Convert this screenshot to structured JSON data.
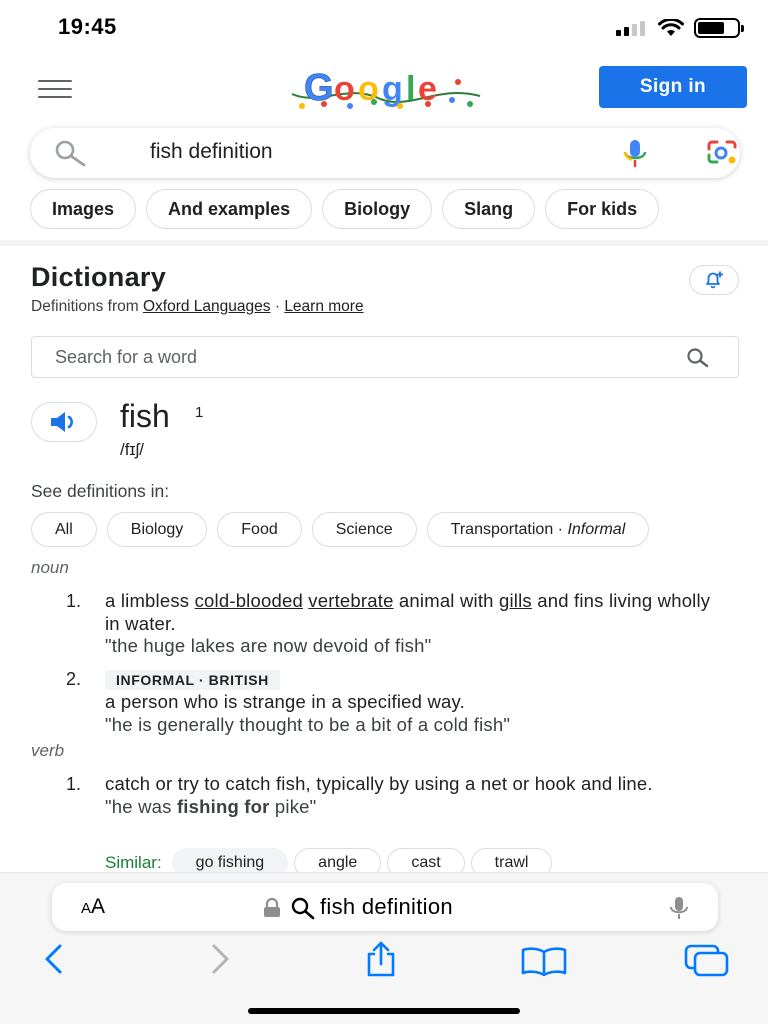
{
  "status_bar": {
    "time": "19:45"
  },
  "header": {
    "sign_in_label": "Sign in",
    "logo_alt": "Google"
  },
  "search": {
    "query": "fish definition"
  },
  "chips": [
    "Images",
    "And examples",
    "Biology",
    "Slang",
    "For kids"
  ],
  "dictionary": {
    "title": "Dictionary",
    "source_prefix": "Definitions from ",
    "source_link": "Oxford Languages",
    "separator": " · ",
    "learn_more": "Learn more",
    "word_search_placeholder": "Search for a word",
    "headword": "fish",
    "headword_sup": "1",
    "pronunciation": "/fɪʃ/",
    "see_definitions_label": "See definitions in:",
    "def_chips": [
      "All",
      "Biology",
      "Food",
      "Science"
    ],
    "def_chip_last": {
      "label": "Transportation",
      "sep": " · ",
      "register": "Informal"
    },
    "noun": {
      "label": "noun",
      "sense1": {
        "num": "1.",
        "t1": "a limbless ",
        "l1": "cold-blooded",
        "t2": " ",
        "l2": "vertebrate",
        "t3": " animal with ",
        "l3": "gills",
        "t4": " and fins living wholly in water.",
        "example": "\"the huge lakes are now devoid of fish\""
      },
      "sense2": {
        "num": "2.",
        "register": "INFORMAL · BRITISH",
        "text": "a person who is strange in a specified way.",
        "example": "\"he is generally thought to be a bit of a cold fish\""
      }
    },
    "verb": {
      "label": "verb",
      "sense1": {
        "num": "1.",
        "text": "catch or try to catch fish, typically by using a net or hook and line.",
        "example_pre": "\"he was ",
        "example_bold": "fishing for",
        "example_post": " pike\""
      },
      "similar_label": "Similar:",
      "similar": [
        "go fishing",
        "angle",
        "cast",
        "trawl"
      ]
    }
  },
  "browser": {
    "aa_small": "A",
    "aa_big": "A",
    "url_text": "fish definition"
  },
  "colors": {
    "accent": "#1a73e8",
    "similar_label": "#188038",
    "chip_border": "#dadce0"
  }
}
